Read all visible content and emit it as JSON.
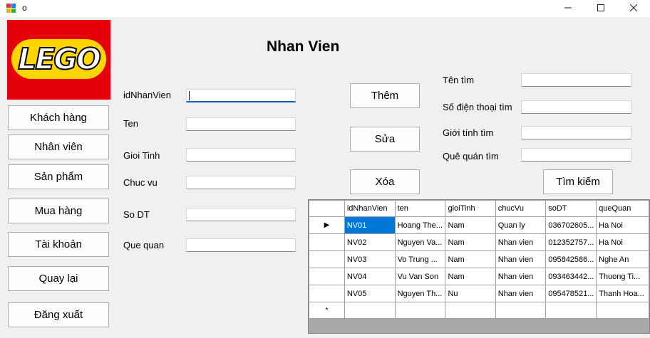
{
  "window": {
    "title": "o",
    "minimize_icon": "minimize-icon",
    "maximize_icon": "maximize-icon",
    "close_icon": "close-icon"
  },
  "logo": {
    "text": "LEGO"
  },
  "nav": [
    {
      "label": "Khách hàng"
    },
    {
      "label": "Nhân viên"
    },
    {
      "label": "Sản phẩm"
    },
    {
      "label": "Mua hàng"
    },
    {
      "label": "Tài khoản"
    },
    {
      "label": "Quay lại"
    },
    {
      "label": "Đăng xuất"
    }
  ],
  "form": {
    "title": "Nhan Vien",
    "fields": [
      {
        "label": "idNhanVien",
        "value": ""
      },
      {
        "label": "Ten",
        "value": ""
      },
      {
        "label": "Gioi Tinh",
        "value": ""
      },
      {
        "label": "Chuc vu",
        "value": ""
      },
      {
        "label": "So DT",
        "value": ""
      },
      {
        "label": "Que quan",
        "value": ""
      }
    ]
  },
  "actions": {
    "add": "Thêm",
    "edit": "Sửa",
    "delete": "Xóa"
  },
  "search": {
    "fields": [
      {
        "label": "Tên tìm",
        "value": ""
      },
      {
        "label": "Số điện thoại tìm",
        "value": ""
      },
      {
        "label": "Giới tính tìm",
        "value": ""
      },
      {
        "label": "Quê quán tìm",
        "value": ""
      }
    ],
    "button": "Tìm kiếm"
  },
  "grid": {
    "columns": [
      "idNhanVien",
      "ten",
      "gioiTinh",
      "chucVu",
      "soDT",
      "queQuan"
    ],
    "rows": [
      [
        "NV01",
        "Hoang The...",
        "Nam",
        "Quan ly",
        "036702605...",
        "Ha Noi"
      ],
      [
        "NV02",
        "Nguyen Va...",
        "Nam",
        "Nhan vien",
        "012352757...",
        "Ha Noi"
      ],
      [
        "NV03",
        "Vo Trung ...",
        "Nam",
        "Nhan vien",
        "095842586...",
        "Nghe An"
      ],
      [
        "NV04",
        "Vu Van Son",
        "Nam",
        "Nhan vien",
        "093463442...",
        "Thuong Ti..."
      ],
      [
        "NV05",
        "Nguyen Th...",
        "Nu",
        "Nhan vien",
        "095478521...",
        "Thanh Hoa..."
      ]
    ],
    "current_row_marker": "▶",
    "new_row_marker": "*",
    "selection_color": "#0078d7"
  }
}
